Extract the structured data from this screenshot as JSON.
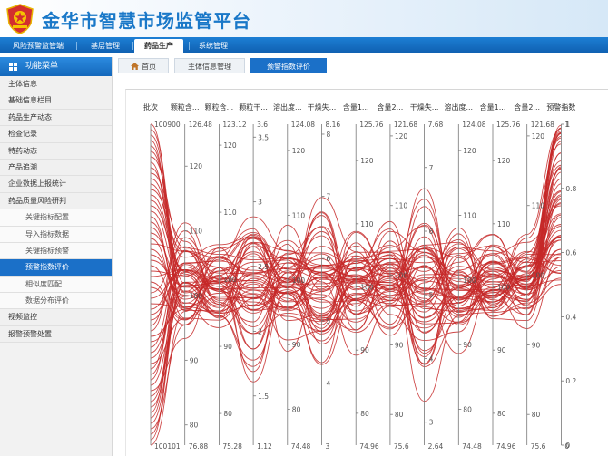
{
  "app": {
    "title": "金华市智慧市场监管平台"
  },
  "topnav": {
    "tabs": [
      {
        "label": "风险预警监管端",
        "active": false
      },
      {
        "label": "基层管理",
        "active": false
      },
      {
        "label": "药品生产",
        "active": true
      },
      {
        "label": "系统管理",
        "active": false
      }
    ]
  },
  "sidebar": {
    "header": "功能菜单",
    "items": [
      {
        "label": "主体信息",
        "sub": false,
        "active": false
      },
      {
        "label": "基础信息栏目",
        "sub": false,
        "active": false
      },
      {
        "label": "药品生产动态",
        "sub": false,
        "active": false
      },
      {
        "label": "检查记录",
        "sub": false,
        "active": false
      },
      {
        "label": "特药动态",
        "sub": false,
        "active": false
      },
      {
        "label": "产品追溯",
        "sub": false,
        "active": false
      },
      {
        "label": "企业数据上报统计",
        "sub": false,
        "active": false
      },
      {
        "label": "药品质量风险研判",
        "sub": false,
        "active": false
      },
      {
        "label": "关键指标配置",
        "sub": true,
        "active": false
      },
      {
        "label": "导入指标数据",
        "sub": true,
        "active": false
      },
      {
        "label": "关键指标预警",
        "sub": true,
        "active": false
      },
      {
        "label": "预警指数评价",
        "sub": true,
        "active": true
      },
      {
        "label": "相似度匹配",
        "sub": true,
        "active": false
      },
      {
        "label": "数据分布评价",
        "sub": true,
        "active": false
      },
      {
        "label": "视频监控",
        "sub": false,
        "active": false
      },
      {
        "label": "报警预警处置",
        "sub": false,
        "active": false
      }
    ]
  },
  "content_tabs": [
    {
      "label": "首页",
      "icon": "home-icon",
      "active": false
    },
    {
      "label": "主体信息管理",
      "active": false
    },
    {
      "label": "预警指数评价",
      "active": true
    }
  ],
  "colors": {
    "brand": "#1a78c8",
    "nav": "#1468bb",
    "line": "#c62828"
  },
  "chart_data": {
    "type": "parallel",
    "axes": [
      {
        "name": "批次",
        "min": "100101",
        "max": "100900",
        "categorical": true,
        "ticks": []
      },
      {
        "name": "颗粒含...",
        "min": 76.88,
        "max": 126.48,
        "ticks": [
          80,
          90,
          100,
          110,
          120
        ]
      },
      {
        "name": "颗粒含...",
        "min": 75.28,
        "max": 123.12,
        "ticks": [
          80,
          90,
          100,
          110,
          120
        ]
      },
      {
        "name": "颗粒干...",
        "min": 1.12,
        "max": 3.6,
        "ticks": [
          1.5,
          2,
          2.5,
          3,
          3.5
        ]
      },
      {
        "name": "溶出度...",
        "min": 74.48,
        "max": 124.08,
        "ticks": [
          80,
          90,
          100,
          110,
          120
        ]
      },
      {
        "name": "干燥失...",
        "min": 3,
        "max": 8.16,
        "ticks": [
          4,
          5,
          6,
          7,
          8
        ]
      },
      {
        "name": "含量1...",
        "min": 74.96,
        "max": 125.76,
        "ticks": [
          80,
          90,
          100,
          110,
          120
        ]
      },
      {
        "name": "含量2...",
        "min": 75.6,
        "max": 121.68,
        "ticks": [
          80,
          90,
          100,
          110,
          120
        ]
      },
      {
        "name": "干燥失...",
        "min": 2.64,
        "max": 7.68,
        "ticks": [
          3,
          4,
          5,
          6,
          7
        ]
      },
      {
        "name": "溶出度...",
        "min": 74.48,
        "max": 124.08,
        "ticks": [
          80,
          90,
          100,
          110,
          120
        ]
      },
      {
        "name": "含量1...",
        "min": 74.96,
        "max": 125.76,
        "ticks": [
          80,
          90,
          100,
          110,
          120
        ]
      },
      {
        "name": "含量2...",
        "min": 75.6,
        "max": 121.68,
        "ticks": [
          80,
          90,
          100,
          110,
          120
        ]
      },
      {
        "name": "预警指数",
        "min": 0,
        "max": 1,
        "ticks": [
          0,
          0.2,
          0.4,
          0.6,
          0.8,
          1
        ]
      }
    ],
    "series_count": 60,
    "line_color": "#c62828"
  }
}
